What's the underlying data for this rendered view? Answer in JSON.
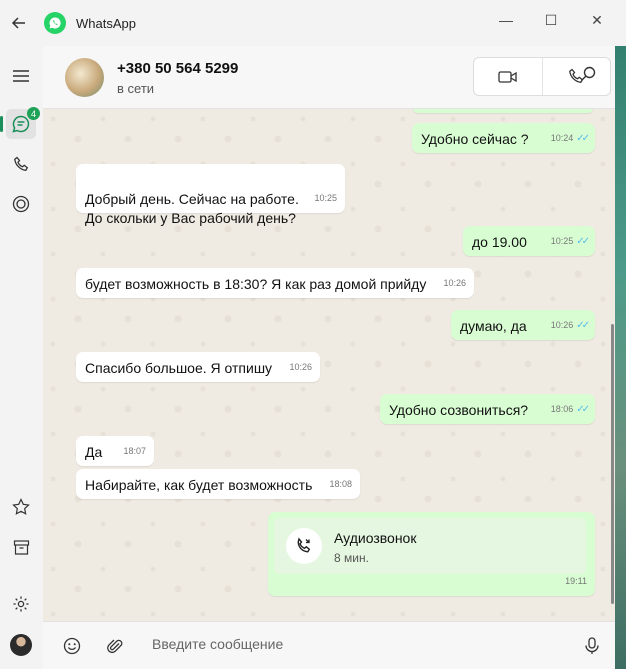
{
  "window": {
    "title": "WhatsApp",
    "minimize": "—",
    "maximize": "☐",
    "close": "✕"
  },
  "rail": {
    "chats_badge": "4"
  },
  "header": {
    "contact_name": "+380 50 564 5299",
    "status": "в сети"
  },
  "messages": [
    {
      "dir": "out",
      "text": "Удобно сейчас ?",
      "time": "10:24",
      "ticks": "✓✓"
    },
    {
      "dir": "in",
      "text": "Добрый день. Сейчас на работе.\nДо скольки у Вас рабочий день?",
      "time": "10:25"
    },
    {
      "dir": "out",
      "text": "до 19.00",
      "time": "10:25",
      "ticks": "✓✓"
    },
    {
      "dir": "in",
      "text": "будет возможность в 18:30? Я как раз домой прийду",
      "time": "10:26"
    },
    {
      "dir": "out",
      "text": "думаю, да",
      "time": "10:26",
      "ticks": "✓✓"
    },
    {
      "dir": "in",
      "text": "Спасибо большое. Я отпишу",
      "time": "10:26"
    },
    {
      "dir": "out",
      "text": "Удобно созвониться?",
      "time": "18:06",
      "ticks": "✓✓"
    },
    {
      "dir": "in",
      "text": "Да",
      "time": "18:07"
    },
    {
      "dir": "in",
      "text": "Набирайте, как будет возможность",
      "time": "18:08"
    }
  ],
  "call_message": {
    "title": "Аудиозвонок",
    "duration": "8 мин.",
    "time": "19:11"
  },
  "composer": {
    "placeholder": "Введите сообщение"
  },
  "colors": {
    "accent": "#25d366",
    "outgoing_bubble": "#d9fdd3",
    "read_ticks": "#53bdeb",
    "badge": "#1da257"
  }
}
